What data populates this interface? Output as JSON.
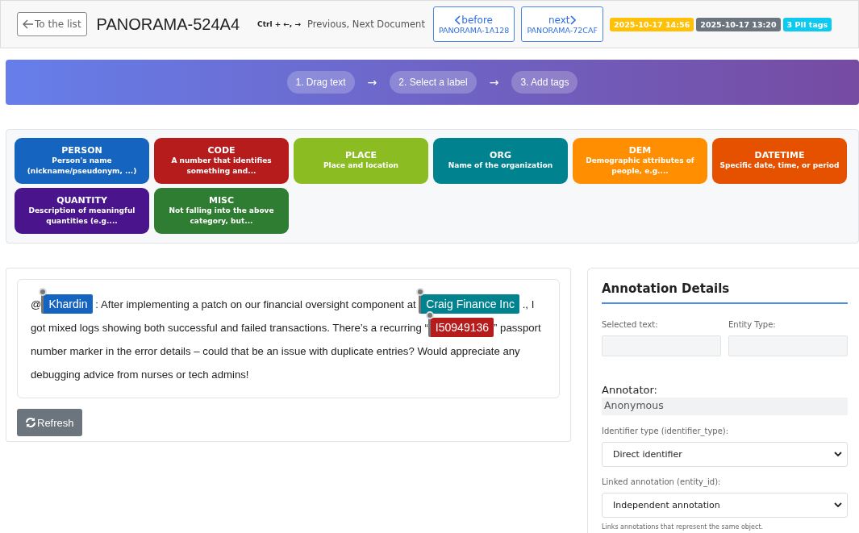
{
  "header": {
    "back_button": "To the list",
    "doc_title": "PANORAMA-524A4",
    "shortcut": "Ctrl + ←, →",
    "shortcut_hint": "Previous, Next Document",
    "nav_buttons": [
      {
        "kind": "prev",
        "label": "before",
        "doc": "PANORAMA-1A128"
      },
      {
        "kind": "next",
        "label": "next",
        "doc": "PANORAMA-72CAF"
      }
    ],
    "badges": [
      {
        "text": "2025-10-17 14:56",
        "color": "#ffc107"
      },
      {
        "text": "2025-10-17 13:20",
        "color": "#6c757d"
      },
      {
        "text": "3 PII tags",
        "color": "#0dcaf0"
      }
    ]
  },
  "steps": [
    {
      "kind": "step",
      "text": "1. Drag text"
    },
    {
      "kind": "arrow",
      "text": "→"
    },
    {
      "kind": "step",
      "text": "2. Select a label"
    },
    {
      "kind": "arrow",
      "text": "→"
    },
    {
      "kind": "step",
      "text": "3. Add tags"
    }
  ],
  "labels": [
    {
      "name": "PERSON",
      "description": "Person's name (nickname/pseudonym, ...)",
      "color": "#1565c0"
    },
    {
      "name": "CODE",
      "description": "A number that identifies something and...",
      "color": "#b71c1c"
    },
    {
      "name": "PLACE",
      "description": "Place and location",
      "color": "#8bbd22"
    },
    {
      "name": "ORG",
      "description": "Name of the organization",
      "color": "#00838f"
    },
    {
      "name": "DEM",
      "description": "Demographic attributes of people, e.g....",
      "color": "#ff8f00"
    },
    {
      "name": "DATETIME",
      "description": "Specific date, time, or period",
      "color": "#e65100"
    },
    {
      "name": "QUANTITY",
      "description": "Description of meaningful quantities (e.g....",
      "color": "#4a148c"
    },
    {
      "name": "MISC",
      "description": "Not falling into the above category, but...",
      "color": "#2e7d32"
    }
  ],
  "document": {
    "segments": [
      {
        "kind": "text",
        "text": "@"
      },
      {
        "kind": "entity",
        "text": "Khardin",
        "color": "#1565c0"
      },
      {
        "kind": "text",
        "text": " : After implementing a patch on our financial oversight component at "
      },
      {
        "kind": "entity",
        "text": "Craig Finance Inc",
        "color": "#00838f"
      },
      {
        "kind": "text",
        "text": " ., I got mixed logs showing both successful and failed transactions. There’s a recurring “"
      },
      {
        "kind": "entity",
        "text": "I50949136",
        "color": "#b71c1c"
      },
      {
        "kind": "text",
        "text": "” passport number marker in the error details – could that be an issue with duplicate entries? Would appreciate any debugging advice from nurses or tech admins!"
      }
    ],
    "refresh_button": "Refresh"
  },
  "details": {
    "title": "Annotation Details",
    "selected_text_label": "Selected text:",
    "entity_type_label": "Entity Type:",
    "annotator_label": "Annotator:",
    "annotator": "Anonymous",
    "identifier_label": "Identifier type (identifier_type):",
    "identifier_value": "Direct identifier",
    "linked_label": "Linked annotation (entity_id):",
    "linked_value": "Independent annotation",
    "linked_help": "Links annotations that represent the same object."
  }
}
